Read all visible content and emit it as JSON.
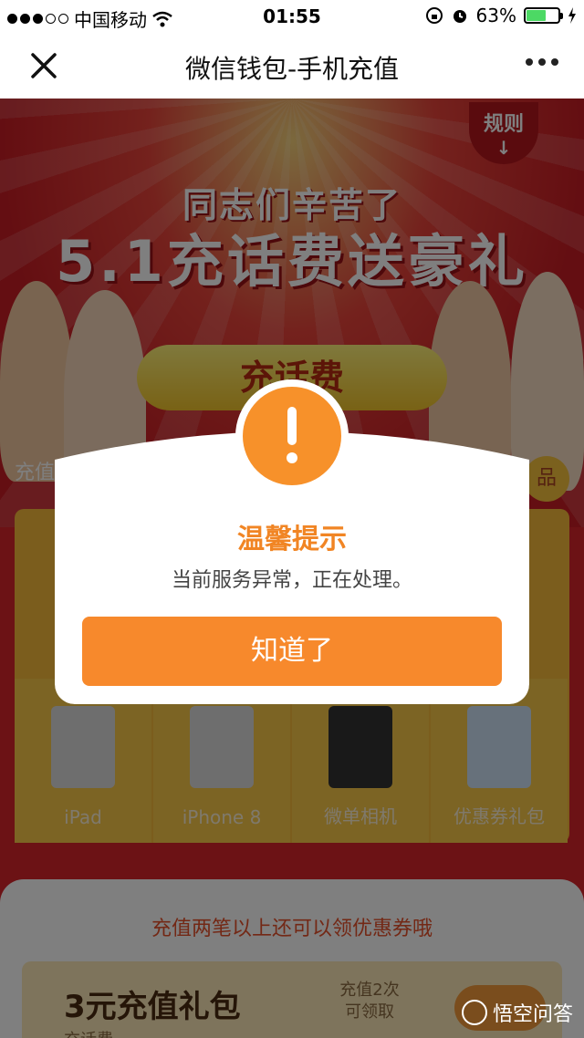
{
  "status_bar": {
    "carrier": "中国移动",
    "time": "01:55",
    "battery": "63%",
    "battery_level": 0.63
  },
  "nav": {
    "title": "微信钱包-手机充值",
    "close_icon": "close-icon",
    "more_icon": "more-icon"
  },
  "banner": {
    "rule_label": "规则",
    "subtitle": "同志们辛苦了",
    "headline": "5.1充话费送豪礼",
    "cta_label": "充话费"
  },
  "sections": {
    "left_label": "充值",
    "right_label": "品"
  },
  "prizes": [
    {
      "label": "iPad"
    },
    {
      "label": "iPhone 8"
    },
    {
      "label": "微单相机"
    },
    {
      "label": "优惠券礼包"
    }
  ],
  "bottom": {
    "note": "充值两笔以上还可以领优惠券哦",
    "ticket_name": "3元充值礼包",
    "ticket_desc": "充话费一",
    "ticket_cond_line1": "充值2次",
    "ticket_cond_line2": "可领取"
  },
  "dialog": {
    "icon": "exclamation-icon",
    "title": "温馨提示",
    "message": "当前服务异常，正在处理。",
    "confirm_label": "知道了",
    "accent_color": "#f7892c"
  },
  "watermark": {
    "text": "悟空问答"
  }
}
